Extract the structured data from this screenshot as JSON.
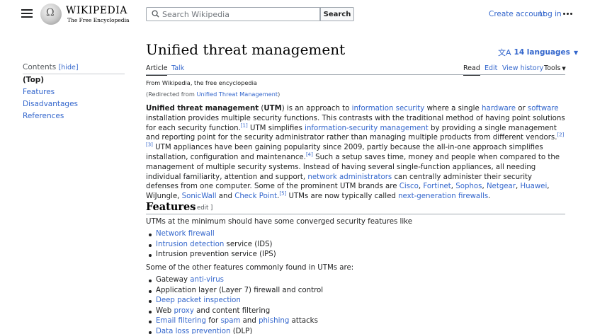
{
  "header": {
    "wordmark_title": "WIKIPEDIA",
    "wordmark_tagline": "The Free Encyclopedia",
    "search_placeholder": "Search Wikipedia",
    "search_button": "Search",
    "create_account": "Create account",
    "log_in": "Log in"
  },
  "sidebar": {
    "contents_label": "Contents",
    "hide_label": "[hide]",
    "items": [
      {
        "label": "(Top)"
      },
      {
        "label": "Features"
      },
      {
        "label": "Disadvantages"
      },
      {
        "label": "References"
      }
    ]
  },
  "page": {
    "title": "Unified threat management",
    "languages": "14 languages",
    "tabs_left": [
      "Article",
      "Talk"
    ],
    "tabs_right": [
      "Read",
      "Edit",
      "View history",
      "Tools"
    ],
    "from_line": "From Wikipedia, the free encyclopedia",
    "redirected_prefix": "(Redirected from ",
    "redirected_link": "Unified Threat Management",
    "redirected_suffix": ")"
  },
  "intro": {
    "t0": "Unified threat management",
    "t1": " (",
    "t2": "UTM",
    "t3": ") is an approach to ",
    "l_infosec": "information security",
    "t4": " where a single ",
    "l_hardware": "hardware",
    "t5": " or ",
    "l_software": "software",
    "t6": " installation provides multiple security functions. This contrasts with the traditional method of having point solutions for each security function.",
    "r1": "[1]",
    "t7": " UTM simplifies ",
    "l_ism": "information-security management",
    "t8": " by providing a single management and reporting point for the security administrator rather than managing multiple products from different vendors.",
    "r2": "[2]",
    "r3": "[3]",
    "t9": " UTM appliances have been gaining popularity since 2009, partly because the all-in-one approach simplifies installation, configuration and maintenance.",
    "r4": "[4]",
    "t10": " Such a setup saves time, money and people when compared to the management of multiple security systems. Instead of having several single-function appliances, all needing individual familiarity, attention and support, ",
    "l_netadmin": "network administrators",
    "t11": " can centrally administer their security defenses from one computer. Some of the prominent UTM brands are ",
    "l_cisco": "Cisco",
    "c1": ", ",
    "l_fortinet": "Fortinet",
    "c2": ", ",
    "l_sophos": "Sophos",
    "c3": ", ",
    "l_netgear": "Netgear",
    "c4": ", ",
    "l_huawei": "Huawei",
    "t12": ", WiJungle, ",
    "l_sonicwall": "SonicWall",
    "t13": " and ",
    "l_checkpoint": "Check Point",
    "t14": ".",
    "r5": "[5]",
    "t15": " UTMs are now typically called ",
    "l_ngfw": "next-generation firewalls",
    "t16": "."
  },
  "features": {
    "heading": "Features",
    "edit": "[ edit ]",
    "intro": "UTMs at the minimum should have some converged security features like",
    "list1": [
      {
        "link": "Network firewall",
        "rest": ""
      },
      {
        "link": "Intrusion detection",
        "rest": " service (IDS)"
      },
      {
        "plain": "Intrusion prevention service (IPS)"
      }
    ],
    "intro2": "Some of the other features commonly found in UTMs are:",
    "list2": {
      "i1_a": "Gateway ",
      "i1_l": "anti-virus",
      "i2": "Application layer (Layer 7) firewall and control",
      "i3_l": "Deep packet inspection",
      "i4_a": "Web ",
      "i4_l": "proxy",
      "i4_b": " and content filtering",
      "i5_l1": "Email filtering",
      "i5_a": " for ",
      "i5_l2": "spam",
      "i5_b": " and ",
      "i5_l3": "phishing",
      "i5_c": " attacks",
      "i6_l": "Data loss prevention",
      "i6_a": " (DLP)"
    }
  }
}
